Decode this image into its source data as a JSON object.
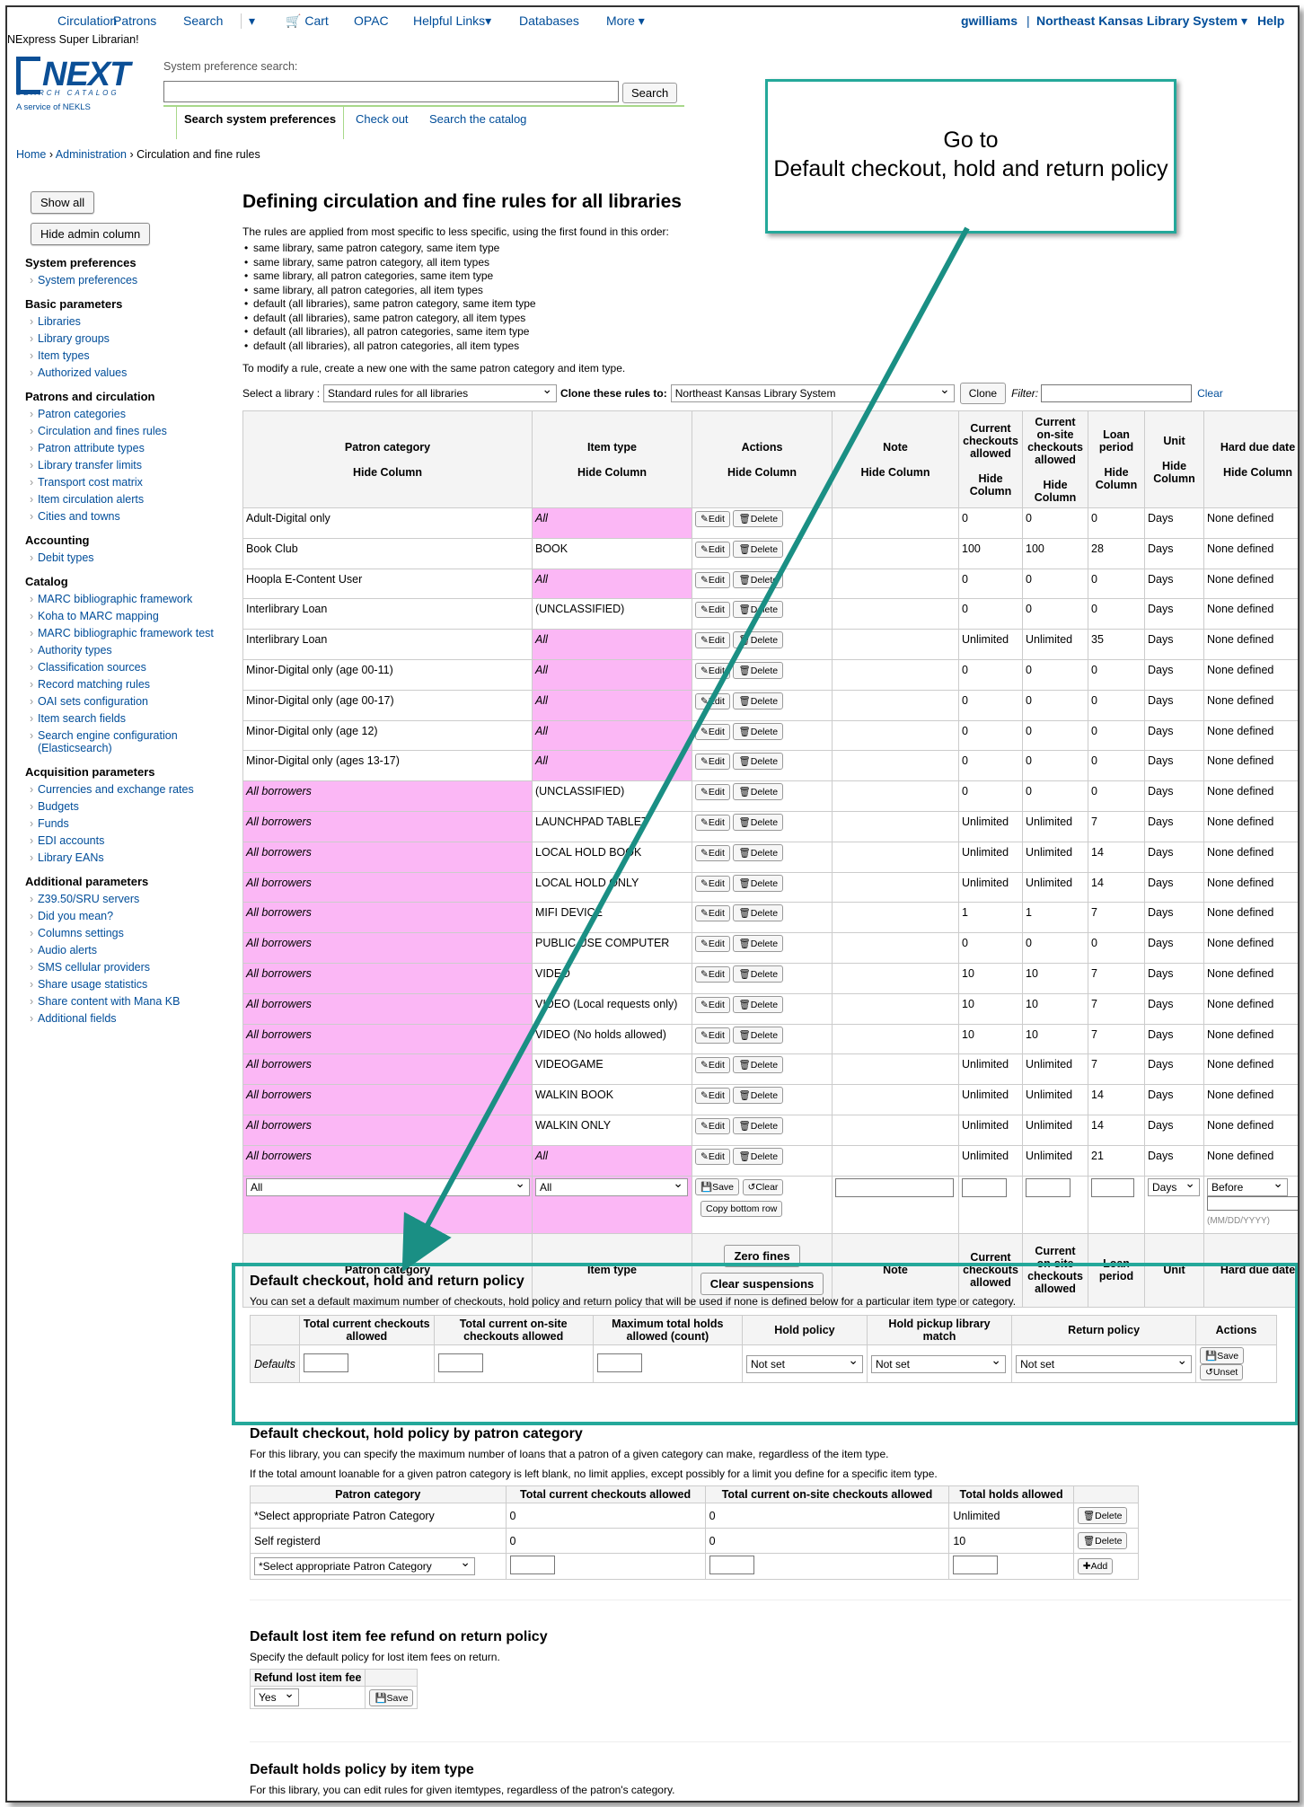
{
  "topnav": {
    "circulation": "Circulation",
    "patrons": "Patrons",
    "search": "Search",
    "cart": "Cart",
    "opac": "OPAC",
    "helpful_links": "Helpful Links",
    "databases": "Databases",
    "more": "More",
    "user": "gwilliams",
    "separator": "|",
    "library": "Northeast Kansas Library System",
    "help": "Help"
  },
  "header": {
    "super_librarian": "NExpress Super Librarian!",
    "logo_text": "NEXT",
    "logo_sub": "SEARCH CATALOG",
    "logo_service": "A service of NEKLS",
    "search_label": "System preference search:",
    "search_button": "Search",
    "tab_active": "Search system preferences",
    "tab_checkout": "Check out",
    "tab_catalog": "Search the catalog"
  },
  "breadcrumb": {
    "home": "Home",
    "admin": "Administration",
    "current": "Circulation and fine rules",
    "sep": "›"
  },
  "sidebar": {
    "show_all": "Show all",
    "hide_admin": "Hide admin column",
    "sections": [
      {
        "title": "System preferences",
        "items": [
          "System preferences"
        ]
      },
      {
        "title": "Basic parameters",
        "items": [
          "Libraries",
          "Library groups",
          "Item types",
          "Authorized values"
        ]
      },
      {
        "title": "Patrons and circulation",
        "items": [
          "Patron categories",
          "Circulation and fines rules",
          "Patron attribute types",
          "Library transfer limits",
          "Transport cost matrix",
          "Item circulation alerts",
          "Cities and towns"
        ]
      },
      {
        "title": "Accounting",
        "items": [
          "Debit types"
        ]
      },
      {
        "title": "Catalog",
        "items": [
          "MARC bibliographic framework",
          "Koha to MARC mapping",
          "MARC bibliographic framework test",
          "Authority types",
          "Classification sources",
          "Record matching rules",
          "OAI sets configuration",
          "Item search fields",
          "Search engine configuration (Elasticsearch)"
        ]
      },
      {
        "title": "Acquisition parameters",
        "items": [
          "Currencies and exchange rates",
          "Budgets",
          "Funds",
          "EDI accounts",
          "Library EANs"
        ]
      },
      {
        "title": "Additional parameters",
        "items": [
          "Z39.50/SRU servers",
          "Did you mean?",
          "Columns settings",
          "Audio alerts",
          "SMS cellular providers",
          "Share usage statistics",
          "Share content with Mana KB",
          "Additional fields"
        ]
      }
    ]
  },
  "main": {
    "title": "Defining circulation and fine rules for all libraries",
    "intro": "The rules are applied from most specific to less specific, using the first found in this order:",
    "rules": [
      "same library, same patron category, same item type",
      "same library, same patron category, all item types",
      "same library, all patron categories, same item type",
      "same library, all patron categories, all item types",
      "default (all libraries), same patron category, same item type",
      "default (all libraries), same patron category, all item types",
      "default (all libraries), all patron categories, same item type",
      "default (all libraries), all patron categories, all item types"
    ],
    "modify_note": "To modify a rule, create a new one with the same patron category and item type.",
    "select_library_label": "Select a library :",
    "select_library_value": "Standard rules for all libraries",
    "clone_label": "Clone these rules to:",
    "clone_value": "Northeast Kansas Library System",
    "clone_button": "Clone",
    "filter_label": "Filter:",
    "clear_link": "Clear"
  },
  "rules_table": {
    "headers": {
      "patron": "Patron category",
      "itemtype": "Item type",
      "actions": "Actions",
      "note": "Note",
      "checkouts": "Current checkouts allowed",
      "onsite": "Current on-site checkouts allowed",
      "loan": "Loan period",
      "unit": "Unit",
      "hard": "Hard due date",
      "hide": "Hide Column"
    },
    "edit": "Edit",
    "delete": "Delete",
    "rows": [
      {
        "patron": "Adult-Digital only",
        "item": "All",
        "c": "0",
        "o": "0",
        "l": "0",
        "u": "Days",
        "h": "None defined"
      },
      {
        "patron": "Book Club",
        "item": "BOOK",
        "c": "100",
        "o": "100",
        "l": "28",
        "u": "Days",
        "h": "None defined"
      },
      {
        "patron": "Hoopla E-Content User",
        "item": "All",
        "c": "0",
        "o": "0",
        "l": "0",
        "u": "Days",
        "h": "None defined"
      },
      {
        "patron": "Interlibrary Loan",
        "item": "(UNCLASSIFIED)",
        "c": "0",
        "o": "0",
        "l": "0",
        "u": "Days",
        "h": "None defined"
      },
      {
        "patron": "Interlibrary Loan",
        "item": "All",
        "c": "Unlimited",
        "o": "Unlimited",
        "l": "35",
        "u": "Days",
        "h": "None defined"
      },
      {
        "patron": "Minor-Digital only (age 00-11)",
        "item": "All",
        "c": "0",
        "o": "0",
        "l": "0",
        "u": "Days",
        "h": "None defined"
      },
      {
        "patron": "Minor-Digital only (age 00-17)",
        "item": "All",
        "c": "0",
        "o": "0",
        "l": "0",
        "u": "Days",
        "h": "None defined"
      },
      {
        "patron": "Minor-Digital only (age 12)",
        "item": "All",
        "c": "0",
        "o": "0",
        "l": "0",
        "u": "Days",
        "h": "None defined"
      },
      {
        "patron": "Minor-Digital only (ages 13-17)",
        "item": "All",
        "c": "0",
        "o": "0",
        "l": "0",
        "u": "Days",
        "h": "None defined"
      },
      {
        "patron": "All borrowers",
        "item": "(UNCLASSIFIED)",
        "c": "0",
        "o": "0",
        "l": "0",
        "u": "Days",
        "h": "None defined"
      },
      {
        "patron": "All borrowers",
        "item": "LAUNCHPAD TABLET",
        "c": "Unlimited",
        "o": "Unlimited",
        "l": "7",
        "u": "Days",
        "h": "None defined"
      },
      {
        "patron": "All borrowers",
        "item": "LOCAL HOLD BOOK",
        "c": "Unlimited",
        "o": "Unlimited",
        "l": "14",
        "u": "Days",
        "h": "None defined"
      },
      {
        "patron": "All borrowers",
        "item": "LOCAL HOLD ONLY",
        "c": "Unlimited",
        "o": "Unlimited",
        "l": "14",
        "u": "Days",
        "h": "None defined"
      },
      {
        "patron": "All borrowers",
        "item": "MIFI DEVICE",
        "c": "1",
        "o": "1",
        "l": "7",
        "u": "Days",
        "h": "None defined"
      },
      {
        "patron": "All borrowers",
        "item": "PUBLIC USE COMPUTER",
        "c": "0",
        "o": "0",
        "l": "0",
        "u": "Days",
        "h": "None defined"
      },
      {
        "patron": "All borrowers",
        "item": "VIDEO",
        "c": "10",
        "o": "10",
        "l": "7",
        "u": "Days",
        "h": "None defined"
      },
      {
        "patron": "All borrowers",
        "item": "VIDEO (Local requests only)",
        "c": "10",
        "o": "10",
        "l": "7",
        "u": "Days",
        "h": "None defined"
      },
      {
        "patron": "All borrowers",
        "item": "VIDEO (No holds allowed)",
        "c": "10",
        "o": "10",
        "l": "7",
        "u": "Days",
        "h": "None defined"
      },
      {
        "patron": "All borrowers",
        "item": "VIDEOGAME",
        "c": "Unlimited",
        "o": "Unlimited",
        "l": "7",
        "u": "Days",
        "h": "None defined"
      },
      {
        "patron": "All borrowers",
        "item": "WALKIN BOOK",
        "c": "Unlimited",
        "o": "Unlimited",
        "l": "14",
        "u": "Days",
        "h": "None defined"
      },
      {
        "patron": "All borrowers",
        "item": "WALKIN ONLY",
        "c": "Unlimited",
        "o": "Unlimited",
        "l": "14",
        "u": "Days",
        "h": "None defined"
      },
      {
        "patron": "All borrowers",
        "item": "All",
        "c": "Unlimited",
        "o": "Unlimited",
        "l": "21",
        "u": "Days",
        "h": "None defined"
      }
    ],
    "edit_row": {
      "patron": "All",
      "item": "All",
      "save": "Save",
      "clear": "Clear",
      "copy": "Copy bottom row",
      "unit": "Days",
      "hard": "Before",
      "date_hint": "(MM/DD/YYYY)"
    },
    "footer": {
      "zero_fines": "Zero fines",
      "clear_susp": "Clear suspensions"
    }
  },
  "callout": {
    "line1": "Go to",
    "line2": "Default checkout, hold and return policy"
  },
  "default_policy": {
    "title": "Default checkout, hold and return policy",
    "desc": "You can set a default maximum number of checkouts, hold policy and return policy that will be used if none is defined below for a particular item type or category.",
    "headers": [
      "Total current checkouts allowed",
      "Total current on-site checkouts allowed",
      "Maximum total holds allowed (count)",
      "Hold policy",
      "Hold pickup library match",
      "Return policy",
      "Actions"
    ],
    "row_label": "Defaults",
    "hold": "Not set",
    "pickup": "Not set",
    "return": "Not set",
    "save": "Save",
    "unset": "Unset"
  },
  "patron_policy": {
    "title": "Default checkout, hold policy by patron category",
    "desc1": "For this library, you can specify the maximum number of loans that a patron of a given category can make, regardless of the item type.",
    "desc2": "If the total amount loanable for a given patron category is left blank, no limit applies, except possibly for a limit you define for a specific item type.",
    "headers": [
      "Patron category",
      "Total current checkouts allowed",
      "Total current on-site checkouts allowed",
      "Total holds allowed"
    ],
    "rows": [
      {
        "cat": "*Select appropriate Patron Category",
        "c": "0",
        "o": "0",
        "h": "Unlimited"
      },
      {
        "cat": "Self registerd",
        "c": "0",
        "o": "0",
        "h": "10"
      }
    ],
    "select": "*Select appropriate Patron Category",
    "delete": "Delete",
    "add": "Add"
  },
  "lost_policy": {
    "title": "Default lost item fee refund on return policy",
    "desc": "Specify the default policy for lost item fees on return.",
    "header": "Refund lost item fee",
    "value": "Yes",
    "save": "Save"
  },
  "holds_policy": {
    "title": "Default holds policy by item type",
    "desc": "For this library, you can edit rules for given itemtypes, regardless of the patron's category."
  }
}
